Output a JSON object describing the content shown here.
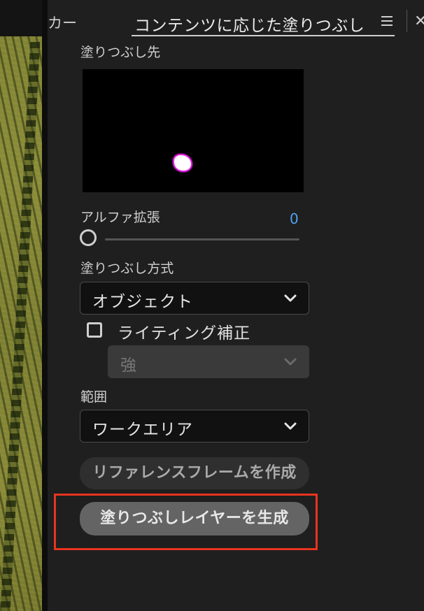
{
  "tabs": {
    "previous_tab_label": "カー",
    "active_tab_label": "コンテンツに応じた塗りつぶし"
  },
  "fill_target": {
    "label": "塗りつぶし先"
  },
  "alpha_expansion": {
    "label": "アルファ拡張",
    "value": "0"
  },
  "fill_method": {
    "label": "塗りつぶし方式",
    "selected": "オブジェクト"
  },
  "lighting_correction": {
    "label": "ライティング補正",
    "checked": false,
    "strength_selected": "強"
  },
  "range": {
    "label": "範囲",
    "selected": "ワークエリア"
  },
  "buttons": {
    "create_reference_frame": "リファレンスフレームを作成",
    "generate_fill_layer": "塗りつぶしレイヤーを生成"
  },
  "colors": {
    "accent_value": "#4da3f5",
    "highlight_box": "#e8341f",
    "mask_outline": "#e020e0"
  }
}
